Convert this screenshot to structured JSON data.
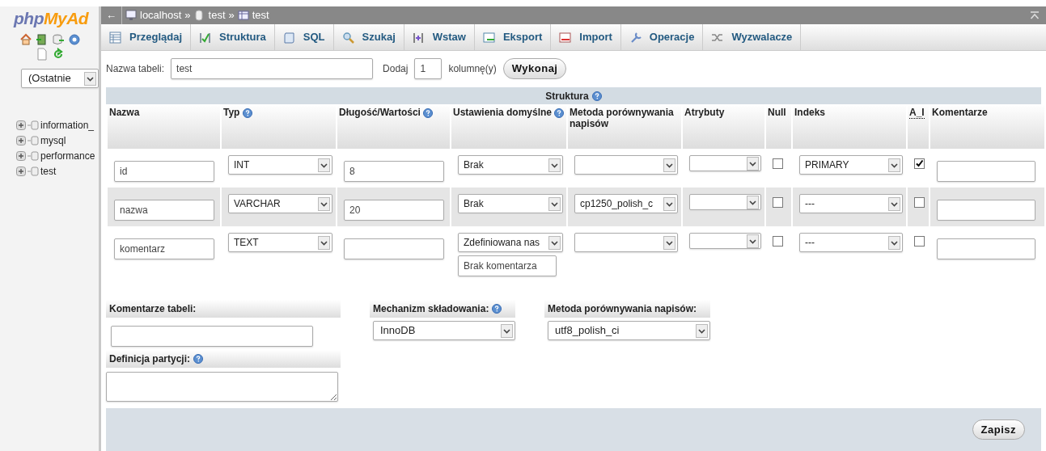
{
  "sidebar": {
    "logo": {
      "part_1": "php",
      "part_2": "MyAd"
    },
    "recent_select": {
      "value": "(Ostatnie"
    },
    "databases": [
      {
        "name": "information_"
      },
      {
        "name": "mysql"
      },
      {
        "name": "performance"
      },
      {
        "name": "test"
      }
    ]
  },
  "breadcrumb": {
    "back": "←",
    "items": [
      {
        "label": "localhost",
        "kind": "server",
        "separator": "»"
      },
      {
        "label": "test",
        "kind": "database",
        "separator": "»"
      },
      {
        "label": "test",
        "kind": "table"
      }
    ]
  },
  "tabs": [
    {
      "label": "Przeglądaj",
      "kind": "browse",
      "selected": false
    },
    {
      "label": "Struktura",
      "kind": "structure",
      "selected": false
    },
    {
      "label": "SQL",
      "kind": "sql",
      "selected": false
    },
    {
      "label": "Szukaj",
      "kind": "search",
      "selected": false
    },
    {
      "label": "Wstaw",
      "kind": "insert",
      "selected": false
    },
    {
      "label": "Eksport",
      "kind": "export",
      "selected": false
    },
    {
      "label": "Import",
      "kind": "import",
      "selected": false
    },
    {
      "label": "Operacje",
      "kind": "operations",
      "selected": false
    },
    {
      "label": "Wyzwalacze",
      "kind": "triggers",
      "selected": false
    }
  ],
  "table_form": {
    "name_label": "Nazwa tabeli:",
    "name_value": "test",
    "add_label": "Dodaj",
    "add_value": "1",
    "add_unit": "kolumnę(y)",
    "go_button": "Wykonaj"
  },
  "structure": {
    "title": "Struktura",
    "help": true,
    "columns": [
      {
        "label": "Nazwa",
        "help": false
      },
      {
        "label": "Typ",
        "help": true
      },
      {
        "label": "Długość/Wartości",
        "help": true
      },
      {
        "label": "Ustawienia domyślne",
        "help": true
      },
      {
        "label": "Metoda porównywania napisów",
        "help": false
      },
      {
        "label": "Atrybuty",
        "help": false
      },
      {
        "label": "Null",
        "help": false
      },
      {
        "label": "Indeks",
        "help": false
      },
      {
        "label": "A_I",
        "help": false,
        "abbreviation": true
      },
      {
        "label": "Komentarze",
        "help": false
      }
    ],
    "rows": [
      {
        "name": "id",
        "type": "INT",
        "length": "8",
        "default": "Brak",
        "collation": "",
        "attributes": "",
        "null": false,
        "index": "PRIMARY",
        "auto_increment": true
      },
      {
        "name": "nazwa",
        "type": "VARCHAR",
        "length": "20",
        "default": "Brak",
        "collation": "cp1250_polish_c",
        "attributes": "",
        "null": false,
        "index": "---",
        "auto_increment": false
      },
      {
        "name": "komentarz",
        "type": "TEXT",
        "length": "",
        "default": "Zdefiniowana nas",
        "default_value": "Brak komentarza",
        "collation": "",
        "attributes": "",
        "null": false,
        "index": "---",
        "auto_increment": false
      }
    ]
  },
  "table_comment": {
    "label": "Komentarze tabeli:"
  },
  "storage_engine": {
    "label": "Mechanizm składowania:",
    "help": true,
    "value": "InnoDB"
  },
  "table_collation": {
    "label": "Metoda porównywania napisów:",
    "value": "utf8_polish_ci"
  },
  "partition": {
    "label": "Definicja partycji:",
    "help": true
  },
  "save_button": "Zapisz"
}
